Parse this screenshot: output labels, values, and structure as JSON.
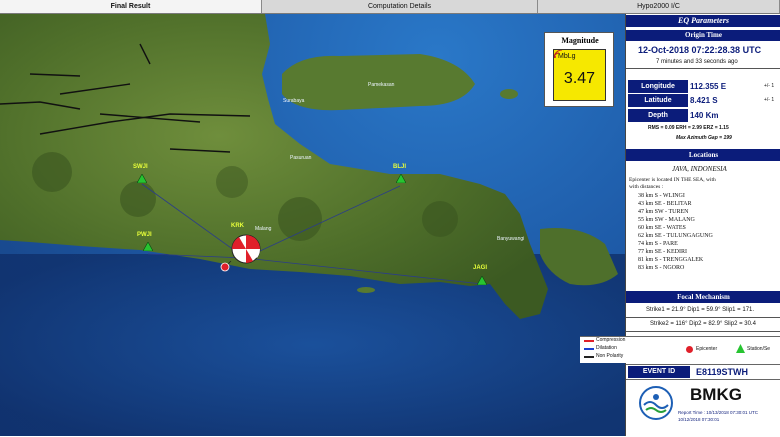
{
  "tabs": [
    "Final Result",
    "Computation Details",
    "Hypo2000 I/C"
  ],
  "map": {
    "places": [
      "Surabaya",
      "Pamekasan",
      "Pasuruan",
      "Malang",
      "Banyuwangi"
    ],
    "stations": [
      {
        "name": "SWJI"
      },
      {
        "name": "BLJI"
      },
      {
        "name": "PWJI"
      },
      {
        "name": "KRK"
      },
      {
        "name": "JAGI"
      }
    ]
  },
  "magnitude": {
    "title": "Magnitude",
    "type": "MbLg",
    "value": "3.47"
  },
  "eq": {
    "header": "EQ Parameters",
    "origin_header": "Origin Time",
    "origin_time": "12-Oct-2018 07:22:28.38 UTC",
    "elapsed": "7 minutes and 33 seconds  ago",
    "longitude_label": "Longitude",
    "longitude": "112.355 E",
    "longitude_err": "+/- 1",
    "latitude_label": "Latitude",
    "latitude": "8.421 S",
    "latitude_err": "+/- 1",
    "depth_label": "Depth",
    "depth": "140 Km",
    "rms": "RMS = 0.09   ERH = 2.99   ERZ = 1.15",
    "gap": "Max Azimuth Gap = 199"
  },
  "locations": {
    "header": "Locations",
    "region": "JAVA, INDONESIA",
    "intro": "Epicenter is located IN THE SEA, with",
    "intro2": "with distances :",
    "items": [
      "38 km S - WLINGI",
      "43 km SE - BELITAR",
      "47 km SW - TUREN",
      "55 km SW - MALANG",
      "60 km SE - WATES",
      "62 km SE - TULUNGAGUNG",
      "74 km S - PARE",
      "77 km SE - KEDIRI",
      "81 km S - TRENGGALEK",
      "83 km S - NGORO"
    ]
  },
  "focal": {
    "header": "Focal Mechanism",
    "line1": "Strike1 = 21.9°  Dip1 = 59.9°  Slip1 = 171.",
    "line2": "Strike2 = 116°  Dip2 = 82.9°  Slip2 = 30.4"
  },
  "legend": {
    "compression": "Compression",
    "dilatation": "Dilatation",
    "nonpolarity": "Non Polarity",
    "epicenter": "Epicenter",
    "station": "Station/Se"
  },
  "event": {
    "label": "EVENT ID",
    "value": "E8119STWH"
  },
  "bmkg": {
    "name": "BMKG",
    "report_time": "Report Time : 10/13/2018 07:30:01 UTC",
    "line2": "10/12/2018 07:30:01"
  },
  "colors": {
    "header_blue": "#0b1c7a",
    "magnitude_yellow": "#f6e800",
    "station_green": "#27c431",
    "epicenter_red": "#e0202a"
  }
}
